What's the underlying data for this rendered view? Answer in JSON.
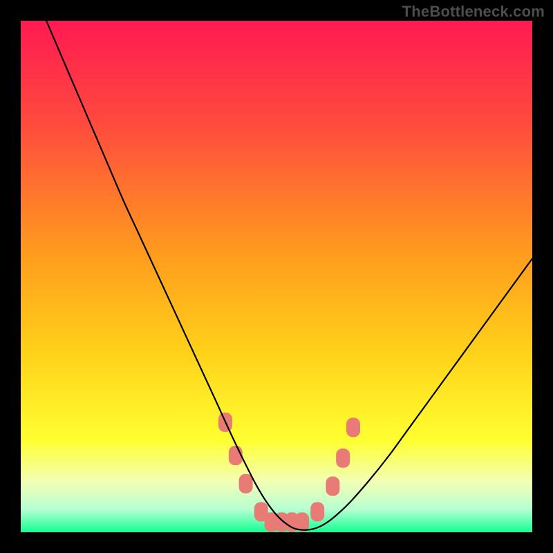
{
  "watermark": "TheBottleneck.com",
  "chart_data": {
    "type": "line",
    "title": "",
    "xlabel": "",
    "ylabel": "",
    "xlim": [
      0,
      100
    ],
    "ylim": [
      0,
      100
    ],
    "grid": false,
    "legend": false,
    "background_gradient": {
      "stops": [
        {
          "pos": 0.0,
          "color": "#ff1a52"
        },
        {
          "pos": 0.2,
          "color": "#ff4a3e"
        },
        {
          "pos": 0.45,
          "color": "#ff9a1e"
        },
        {
          "pos": 0.65,
          "color": "#ffd21a"
        },
        {
          "pos": 0.82,
          "color": "#ffff30"
        },
        {
          "pos": 0.9,
          "color": "#f3ffb4"
        },
        {
          "pos": 0.955,
          "color": "#b7ffd2"
        },
        {
          "pos": 1.0,
          "color": "#13ff93"
        }
      ]
    },
    "series": [
      {
        "name": "bottleneck-curve",
        "color": "#000000",
        "stroke_width": 2.2,
        "x": [
          5,
          8,
          11,
          14,
          17,
          20,
          23,
          26,
          29,
          32,
          35,
          38,
          40,
          42,
          44,
          46,
          48,
          50,
          52,
          54,
          57,
          60,
          64,
          68,
          72,
          76,
          80,
          84,
          88,
          92,
          96,
          100
        ],
        "y": [
          100,
          93,
          86,
          79,
          72,
          65,
          58.5,
          52,
          45.5,
          39,
          32.5,
          26,
          21.6,
          17.3,
          13.2,
          9.3,
          6.0,
          3.4,
          1.6,
          0.6,
          0.6,
          2.0,
          5.5,
          10.0,
          15.0,
          20.5,
          26.0,
          31.5,
          37.0,
          42.5,
          48.0,
          53.5
        ]
      }
    ],
    "markers": {
      "name": "bottom-dots",
      "shape": "rounded-rect",
      "color": "#e97b76",
      "points": [
        {
          "x": 40,
          "y": 21.5
        },
        {
          "x": 42,
          "y": 15.0
        },
        {
          "x": 44,
          "y": 9.5
        },
        {
          "x": 47,
          "y": 4.0
        },
        {
          "x": 49,
          "y": 2.0
        },
        {
          "x": 51,
          "y": 2.0
        },
        {
          "x": 53,
          "y": 2.0
        },
        {
          "x": 55,
          "y": 2.0
        },
        {
          "x": 58,
          "y": 4.0
        },
        {
          "x": 61,
          "y": 9.0
        },
        {
          "x": 63,
          "y": 14.5
        },
        {
          "x": 65,
          "y": 20.5
        }
      ]
    }
  }
}
